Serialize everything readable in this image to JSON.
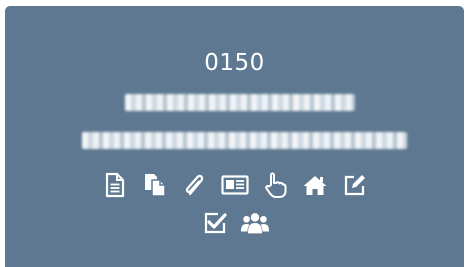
{
  "record": {
    "number": "0150",
    "line1_redacted": "",
    "line2_redacted": ""
  },
  "actions_row1": [
    {
      "icon": "document-icon"
    },
    {
      "icon": "copy-icon"
    },
    {
      "icon": "paperclip-icon"
    },
    {
      "icon": "id-card-icon"
    },
    {
      "icon": "pointer-hand-icon"
    },
    {
      "icon": "home-icon"
    },
    {
      "icon": "edit-icon"
    }
  ],
  "actions_row2": [
    {
      "icon": "checkbox-icon"
    },
    {
      "icon": "users-icon"
    }
  ],
  "colors": {
    "card_background": "#5d7890",
    "foreground": "#ffffff"
  }
}
